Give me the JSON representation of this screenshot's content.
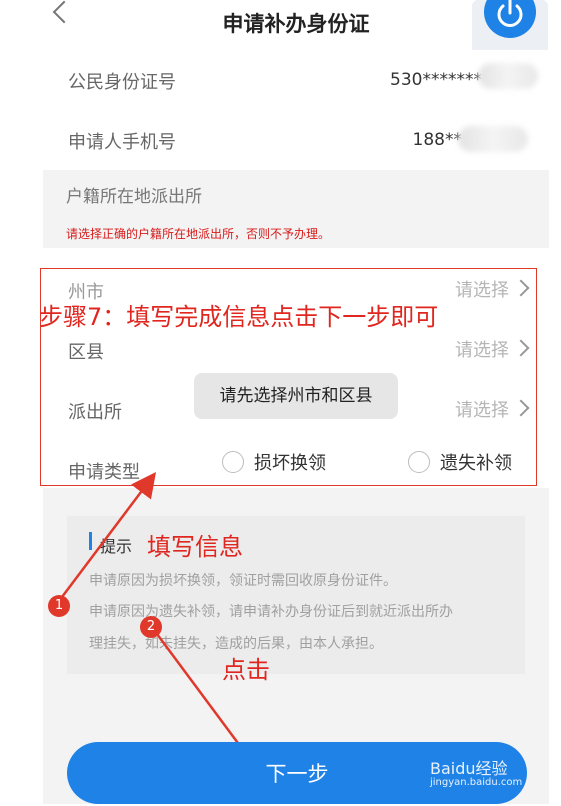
{
  "header": {
    "title": "申请补办身份证"
  },
  "personal": {
    "id_label": "公民身份证号",
    "id_value": "530*********",
    "phone_label": "申请人手机号",
    "phone_value": "188**"
  },
  "station": {
    "section_title": "户籍所在地派出所",
    "warning": "请选择正确的户籍所在地派出所，否则不予办理。",
    "city_label": "州市",
    "district_label": "区县",
    "office_label": "派出所",
    "select_placeholder": "请选择",
    "toast": "请先选择州市和区县",
    "type_label": "申请类型",
    "type_options": [
      "损坏换领",
      "遗失补领"
    ]
  },
  "tips": {
    "title": "提示",
    "line1": "申请原因为损坏换领，领证时需回收原身份证件。",
    "line2": "申请原因为遗失补领，请申请补办身份证后到就近派出所办",
    "line3": "理挂失，如未挂失，造成的后果，由本人承担。"
  },
  "next_button": "下一步",
  "annotations": {
    "step_text": "步骤7：填写完成信息点击下一步即可",
    "fill_text": "填写信息",
    "click_text": "点击",
    "badge1": "1",
    "badge2": "2"
  },
  "watermark": {
    "brand": "Baidu经验",
    "url": "jingyan.baidu.com"
  },
  "colors": {
    "accent": "#1e82e6",
    "annotation_red": "#e0261e",
    "warning_red": "#d81b1b"
  }
}
